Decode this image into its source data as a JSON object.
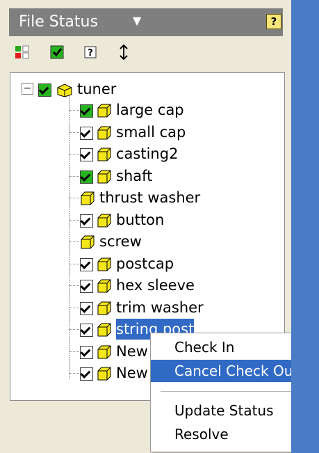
{
  "header": {
    "title": "File Status",
    "help_glyph": "?"
  },
  "toolbar": {
    "items": [
      {
        "name": "grid-view-icon"
      },
      {
        "name": "checked-out-icon"
      },
      {
        "name": "unknown-status-icon"
      },
      {
        "name": "refresh-icon"
      }
    ]
  },
  "tree": {
    "root": {
      "label": "tuner",
      "expander": "−"
    },
    "items": [
      {
        "label": "large cap",
        "check": "green"
      },
      {
        "label": "small cap",
        "check": "white"
      },
      {
        "label": "casting2",
        "check": "white"
      },
      {
        "label": "shaft",
        "check": "green"
      },
      {
        "label": "thrust washer",
        "check": "none"
      },
      {
        "label": "button",
        "check": "white"
      },
      {
        "label": "screw",
        "check": "none"
      },
      {
        "label": "postcap",
        "check": "white"
      },
      {
        "label": "hex sleeve",
        "check": "white"
      },
      {
        "label": "trim washer",
        "check": "white"
      },
      {
        "label": "string post",
        "check": "white",
        "selected": true
      },
      {
        "label": "New",
        "check": "white"
      },
      {
        "label": "New",
        "check": "white"
      }
    ]
  },
  "menu": {
    "items": [
      {
        "label": "Check In"
      },
      {
        "label": "Cancel Check Out",
        "highlight": true
      },
      {
        "label": "Update Status"
      },
      {
        "label": "Resolve"
      }
    ]
  },
  "colors": {
    "selection": "#316ac5",
    "check_green": "#27b51f",
    "panel": "#ece9d8",
    "header": "#7f7f7f"
  }
}
